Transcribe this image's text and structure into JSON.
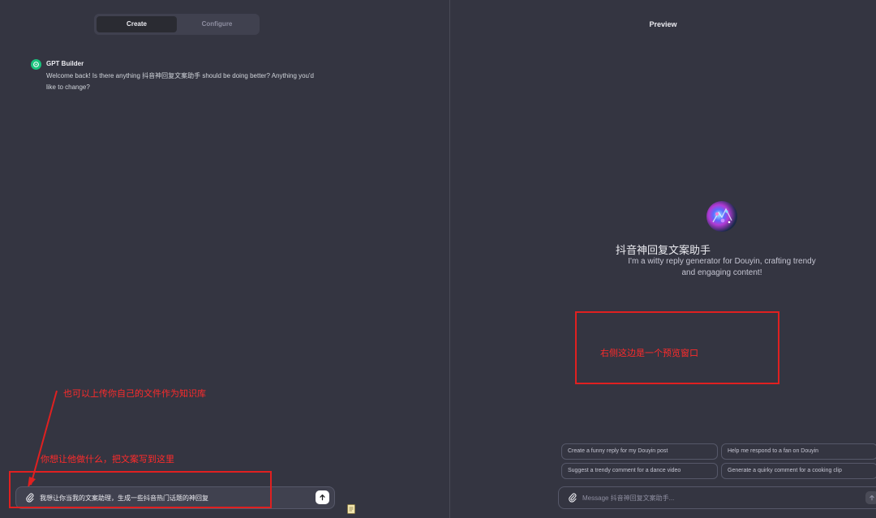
{
  "tabs": {
    "create": "Create",
    "configure": "Configure",
    "active": "create"
  },
  "builder": {
    "name": "GPT Builder",
    "message": "Welcome back! Is there anything 抖音神回复文案助手 should be doing better? Anything you'd like to change?"
  },
  "annotations": {
    "upload_hint": "也可以上传你自己的文件作为知识库",
    "input_hint": "你想让他做什么，把文案写到这里",
    "preview_hint": "右侧这边是一个预览窗口"
  },
  "composer": {
    "text": "我想让你当我的文案助理，生成一些抖音热门话题的神回复",
    "send_icon": "arrow-up-icon",
    "attach_icon": "paperclip-icon"
  },
  "preview": {
    "title": "Preview",
    "gpt_name": "抖音神回复文案助手",
    "gpt_description": "I'm a witty reply generator for Douyin, crafting trendy and engaging content!",
    "suggestions": [
      "Create a funny reply for my Douyin post",
      "Help me respond to a fan on Douyin",
      "Suggest a trendy comment for a dance video",
      "Generate a quirky comment for a cooking clip"
    ],
    "composer_placeholder": "Message 抖音神回复文案助手..."
  },
  "colors": {
    "background": "#343541",
    "annotation_red": "#e02020",
    "builder_avatar": "#19c37d"
  }
}
